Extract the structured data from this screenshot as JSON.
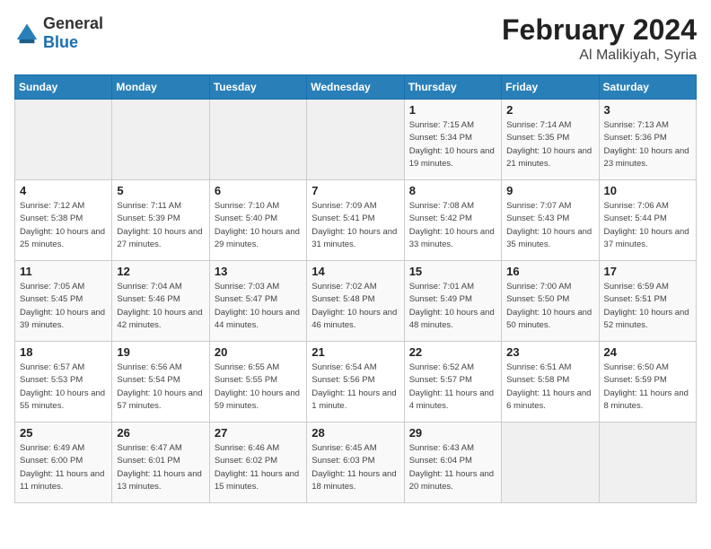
{
  "logo": {
    "general": "General",
    "blue": "Blue"
  },
  "title": "February 2024",
  "location": "Al Malikiyah, Syria",
  "days_of_week": [
    "Sunday",
    "Monday",
    "Tuesday",
    "Wednesday",
    "Thursday",
    "Friday",
    "Saturday"
  ],
  "weeks": [
    [
      {
        "day": "",
        "sunrise": "",
        "sunset": "",
        "daylight": ""
      },
      {
        "day": "",
        "sunrise": "",
        "sunset": "",
        "daylight": ""
      },
      {
        "day": "",
        "sunrise": "",
        "sunset": "",
        "daylight": ""
      },
      {
        "day": "",
        "sunrise": "",
        "sunset": "",
        "daylight": ""
      },
      {
        "day": "1",
        "sunrise": "Sunrise: 7:15 AM",
        "sunset": "Sunset: 5:34 PM",
        "daylight": "Daylight: 10 hours and 19 minutes."
      },
      {
        "day": "2",
        "sunrise": "Sunrise: 7:14 AM",
        "sunset": "Sunset: 5:35 PM",
        "daylight": "Daylight: 10 hours and 21 minutes."
      },
      {
        "day": "3",
        "sunrise": "Sunrise: 7:13 AM",
        "sunset": "Sunset: 5:36 PM",
        "daylight": "Daylight: 10 hours and 23 minutes."
      }
    ],
    [
      {
        "day": "4",
        "sunrise": "Sunrise: 7:12 AM",
        "sunset": "Sunset: 5:38 PM",
        "daylight": "Daylight: 10 hours and 25 minutes."
      },
      {
        "day": "5",
        "sunrise": "Sunrise: 7:11 AM",
        "sunset": "Sunset: 5:39 PM",
        "daylight": "Daylight: 10 hours and 27 minutes."
      },
      {
        "day": "6",
        "sunrise": "Sunrise: 7:10 AM",
        "sunset": "Sunset: 5:40 PM",
        "daylight": "Daylight: 10 hours and 29 minutes."
      },
      {
        "day": "7",
        "sunrise": "Sunrise: 7:09 AM",
        "sunset": "Sunset: 5:41 PM",
        "daylight": "Daylight: 10 hours and 31 minutes."
      },
      {
        "day": "8",
        "sunrise": "Sunrise: 7:08 AM",
        "sunset": "Sunset: 5:42 PM",
        "daylight": "Daylight: 10 hours and 33 minutes."
      },
      {
        "day": "9",
        "sunrise": "Sunrise: 7:07 AM",
        "sunset": "Sunset: 5:43 PM",
        "daylight": "Daylight: 10 hours and 35 minutes."
      },
      {
        "day": "10",
        "sunrise": "Sunrise: 7:06 AM",
        "sunset": "Sunset: 5:44 PM",
        "daylight": "Daylight: 10 hours and 37 minutes."
      }
    ],
    [
      {
        "day": "11",
        "sunrise": "Sunrise: 7:05 AM",
        "sunset": "Sunset: 5:45 PM",
        "daylight": "Daylight: 10 hours and 39 minutes."
      },
      {
        "day": "12",
        "sunrise": "Sunrise: 7:04 AM",
        "sunset": "Sunset: 5:46 PM",
        "daylight": "Daylight: 10 hours and 42 minutes."
      },
      {
        "day": "13",
        "sunrise": "Sunrise: 7:03 AM",
        "sunset": "Sunset: 5:47 PM",
        "daylight": "Daylight: 10 hours and 44 minutes."
      },
      {
        "day": "14",
        "sunrise": "Sunrise: 7:02 AM",
        "sunset": "Sunset: 5:48 PM",
        "daylight": "Daylight: 10 hours and 46 minutes."
      },
      {
        "day": "15",
        "sunrise": "Sunrise: 7:01 AM",
        "sunset": "Sunset: 5:49 PM",
        "daylight": "Daylight: 10 hours and 48 minutes."
      },
      {
        "day": "16",
        "sunrise": "Sunrise: 7:00 AM",
        "sunset": "Sunset: 5:50 PM",
        "daylight": "Daylight: 10 hours and 50 minutes."
      },
      {
        "day": "17",
        "sunrise": "Sunrise: 6:59 AM",
        "sunset": "Sunset: 5:51 PM",
        "daylight": "Daylight: 10 hours and 52 minutes."
      }
    ],
    [
      {
        "day": "18",
        "sunrise": "Sunrise: 6:57 AM",
        "sunset": "Sunset: 5:53 PM",
        "daylight": "Daylight: 10 hours and 55 minutes."
      },
      {
        "day": "19",
        "sunrise": "Sunrise: 6:56 AM",
        "sunset": "Sunset: 5:54 PM",
        "daylight": "Daylight: 10 hours and 57 minutes."
      },
      {
        "day": "20",
        "sunrise": "Sunrise: 6:55 AM",
        "sunset": "Sunset: 5:55 PM",
        "daylight": "Daylight: 10 hours and 59 minutes."
      },
      {
        "day": "21",
        "sunrise": "Sunrise: 6:54 AM",
        "sunset": "Sunset: 5:56 PM",
        "daylight": "Daylight: 11 hours and 1 minute."
      },
      {
        "day": "22",
        "sunrise": "Sunrise: 6:52 AM",
        "sunset": "Sunset: 5:57 PM",
        "daylight": "Daylight: 11 hours and 4 minutes."
      },
      {
        "day": "23",
        "sunrise": "Sunrise: 6:51 AM",
        "sunset": "Sunset: 5:58 PM",
        "daylight": "Daylight: 11 hours and 6 minutes."
      },
      {
        "day": "24",
        "sunrise": "Sunrise: 6:50 AM",
        "sunset": "Sunset: 5:59 PM",
        "daylight": "Daylight: 11 hours and 8 minutes."
      }
    ],
    [
      {
        "day": "25",
        "sunrise": "Sunrise: 6:49 AM",
        "sunset": "Sunset: 6:00 PM",
        "daylight": "Daylight: 11 hours and 11 minutes."
      },
      {
        "day": "26",
        "sunrise": "Sunrise: 6:47 AM",
        "sunset": "Sunset: 6:01 PM",
        "daylight": "Daylight: 11 hours and 13 minutes."
      },
      {
        "day": "27",
        "sunrise": "Sunrise: 6:46 AM",
        "sunset": "Sunset: 6:02 PM",
        "daylight": "Daylight: 11 hours and 15 minutes."
      },
      {
        "day": "28",
        "sunrise": "Sunrise: 6:45 AM",
        "sunset": "Sunset: 6:03 PM",
        "daylight": "Daylight: 11 hours and 18 minutes."
      },
      {
        "day": "29",
        "sunrise": "Sunrise: 6:43 AM",
        "sunset": "Sunset: 6:04 PM",
        "daylight": "Daylight: 11 hours and 20 minutes."
      },
      {
        "day": "",
        "sunrise": "",
        "sunset": "",
        "daylight": ""
      },
      {
        "day": "",
        "sunrise": "",
        "sunset": "",
        "daylight": ""
      }
    ]
  ]
}
